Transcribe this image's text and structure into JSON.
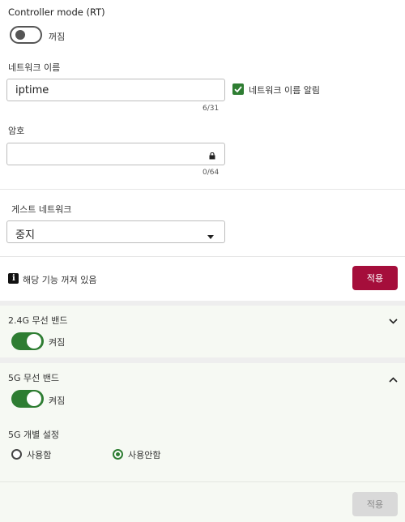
{
  "controller": {
    "label": "Controller mode (RT)",
    "state": "꺼짐",
    "on": false
  },
  "network_name": {
    "label": "네트워크 이름",
    "value": "iptime",
    "placeholder": "",
    "counter": "6/31",
    "broadcast_label": "네트워크 이름 알림",
    "broadcast_checked": true
  },
  "password": {
    "label": "암호",
    "value": "",
    "counter": "0/64",
    "lock_icon": "lock-icon"
  },
  "guest": {
    "label": "게스트 네트워크",
    "selected": "중지",
    "info_text": "해당 기능 꺼져 있음",
    "apply_label": "적용"
  },
  "band_24": {
    "label": "2.4G 무선 밴드",
    "state": "켜짐",
    "on": true,
    "expanded": false
  },
  "band_5": {
    "label": "5G 무선 밴드",
    "state": "켜짐",
    "on": true,
    "expanded": true,
    "individual_label": "5G 개별 설정",
    "options": [
      "사용함",
      "사용안함"
    ],
    "selected_option": "사용안함",
    "apply_label": "적용"
  },
  "colors": {
    "accent_green": "#2e7d32",
    "apply_red": "#a50e3b",
    "panel_bg": "#f6f9f3"
  }
}
